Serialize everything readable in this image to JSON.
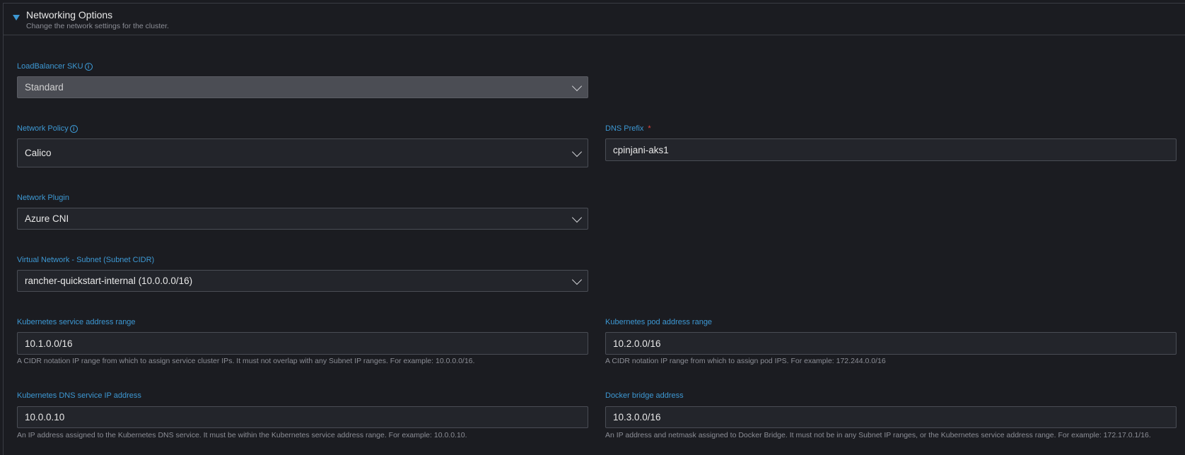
{
  "section": {
    "title": "Networking Options",
    "subtitle": "Change the network settings for the cluster."
  },
  "fields": {
    "lb_sku": {
      "label": "LoadBalancer SKU",
      "value": "Standard"
    },
    "network_policy": {
      "label": "Network Policy",
      "value": "Calico"
    },
    "dns_prefix": {
      "label": "DNS Prefix",
      "required_mark": "*",
      "value": "cpinjani-aks1"
    },
    "network_plugin": {
      "label": "Network Plugin",
      "value": "Azure CNI"
    },
    "vnet_subnet": {
      "label": "Virtual Network - Subnet (Subnet CIDR)",
      "value": "rancher-quickstart-internal (10.0.0.0/16)"
    },
    "service_range": {
      "label": "Kubernetes service address range",
      "value": "10.1.0.0/16",
      "help": "A CIDR notation IP range from which to assign service cluster IPs. It must not overlap with any Subnet IP ranges. For example: 10.0.0.0/16."
    },
    "pod_range": {
      "label": "Kubernetes pod address range",
      "value": "10.2.0.0/16",
      "help": "A CIDR notation IP range from which to assign pod IPS. For example: 172.244.0.0/16"
    },
    "dns_service_ip": {
      "label": "Kubernetes DNS service IP address",
      "value": "10.0.0.10",
      "help": "An IP address assigned to the Kubernetes DNS service. It must be within the Kubernetes service address range. For example: 10.0.0.10."
    },
    "docker_bridge": {
      "label": "Docker bridge address",
      "value": "10.3.0.0/16",
      "help": "An IP address and netmask assigned to Docker Bridge. It must not be in any Subnet IP ranges, or the Kubernetes service address range. For example: 172.17.0.1/16."
    }
  },
  "icons": {
    "info": "i"
  },
  "colors": {
    "accent": "#3d98d3",
    "required": "#e2433d",
    "background": "#1b1c21"
  }
}
